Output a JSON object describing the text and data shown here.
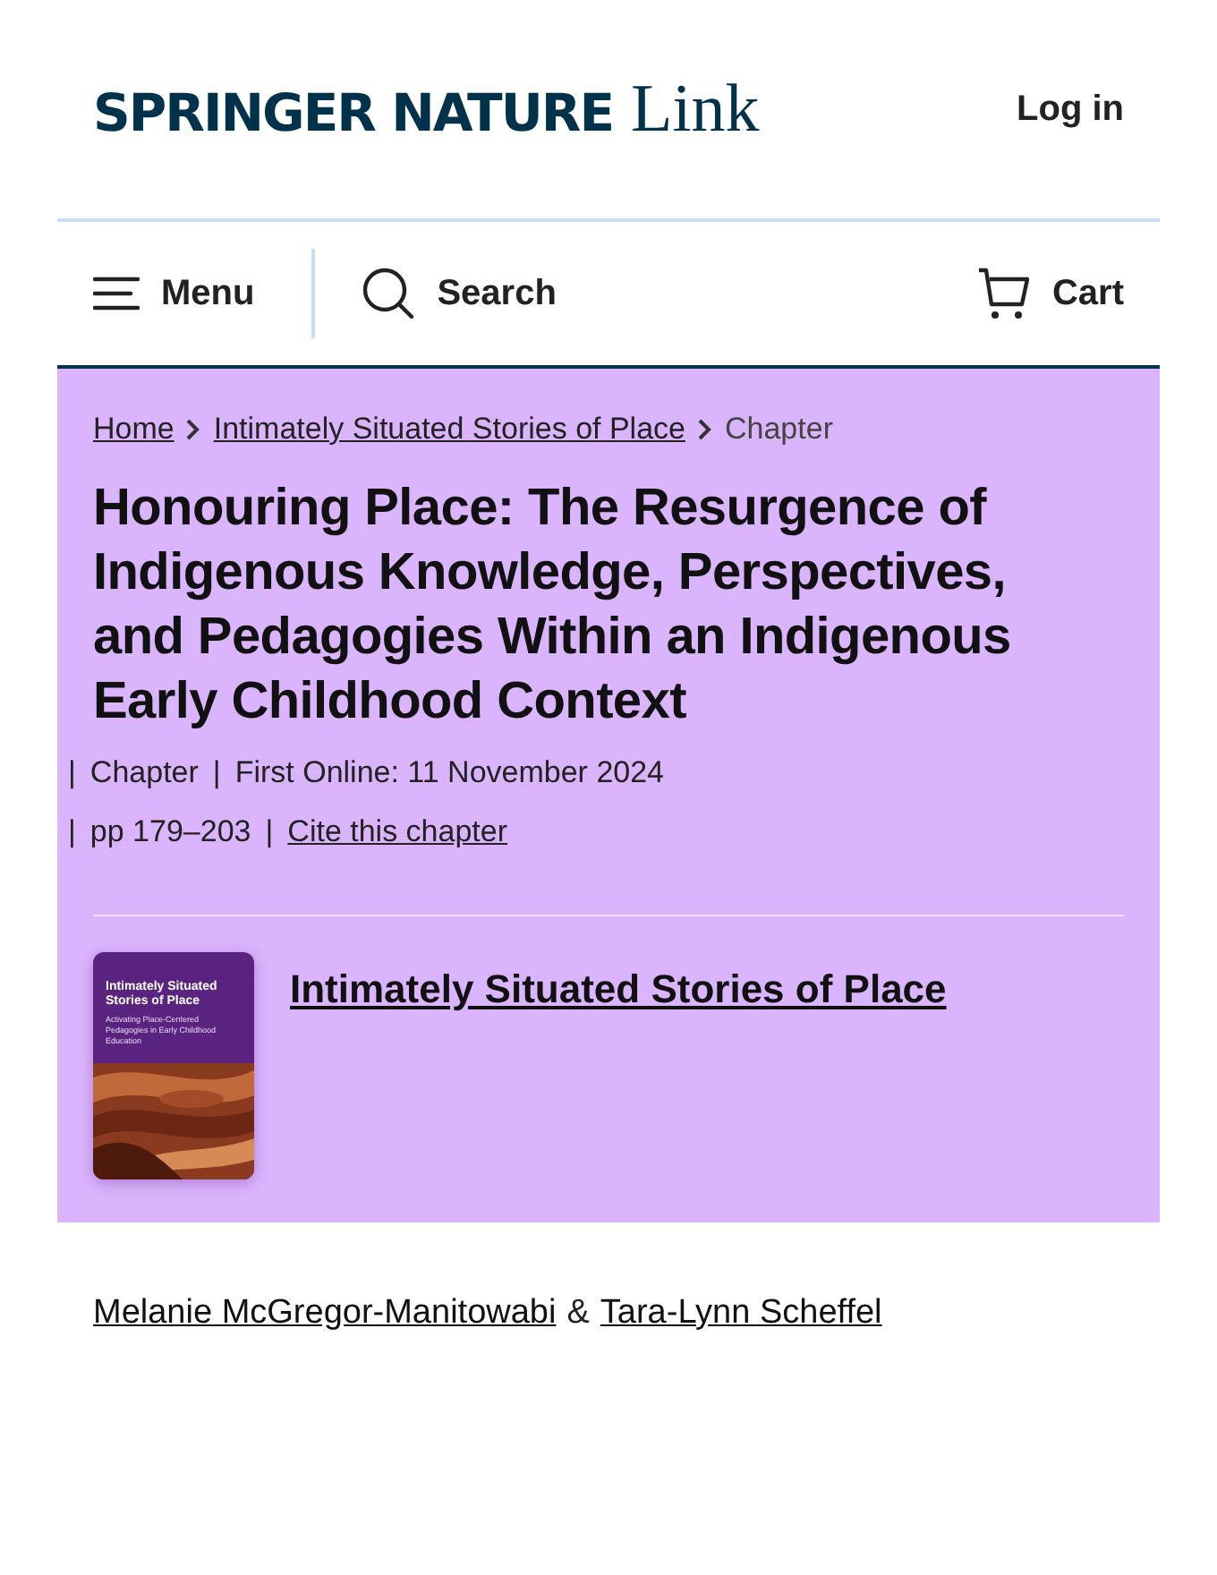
{
  "header": {
    "logo": {
      "brand": "SPRINGER NATURE",
      "product": "Link"
    },
    "login": "Log in"
  },
  "nav": [
    {
      "kind": "menu",
      "label": "Menu"
    },
    {
      "kind": "search",
      "label": "Search"
    },
    {
      "kind": "cart",
      "label": "Cart"
    }
  ],
  "breadcrumbs": [
    {
      "label": "Home",
      "link": true
    },
    {
      "label": "Intimately Situated Stories of Place",
      "link": true
    },
    {
      "label": "Chapter",
      "link": false
    }
  ],
  "title": "Honouring Place: The Resurgence of Indigenous Knowledge, Perspectives, and Pedagogies Within an Indigenous Early Childhood Context",
  "meta_separator": "|",
  "meta_lines": [
    [
      {
        "text": "Chapter",
        "link": false
      },
      {
        "text": "First Online: 11 November 2024",
        "link": false
      }
    ],
    [
      {
        "text": "pp 179–203",
        "link": false
      },
      {
        "text": "Cite this chapter",
        "link": true
      }
    ]
  ],
  "book": {
    "cover": {
      "title": "Intimately Situated Stories of Place",
      "subtitle": "Activating Place-Centered Pedagogies in Early Childhood Education"
    },
    "title": "Intimately Situated Stories of Place"
  },
  "authors": {
    "names": [
      "Melanie McGregor-Manitowabi",
      "Tara-Lynn Scheffel"
    ],
    "joiner": "&"
  }
}
